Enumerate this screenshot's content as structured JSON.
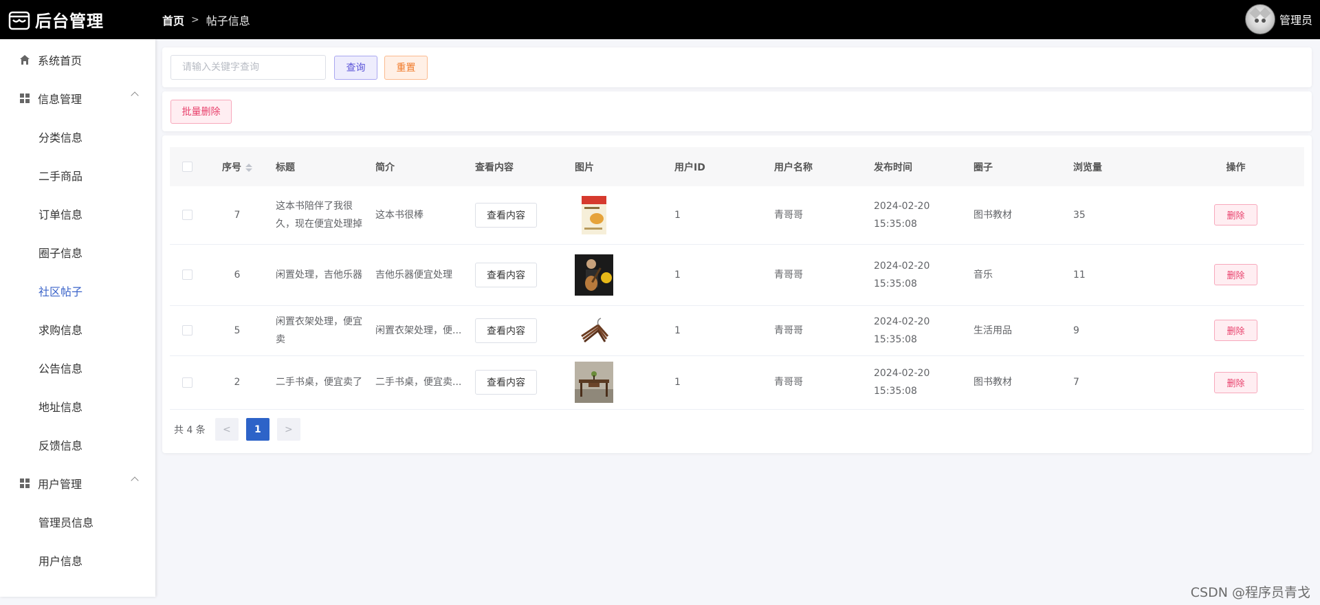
{
  "header": {
    "app_title": "后台管理",
    "breadcrumb_home": "首页",
    "breadcrumb_current": "帖子信息",
    "user_name": "管理员"
  },
  "sidebar": {
    "home": "系统首页",
    "group_info": "信息管理",
    "info_items": [
      "分类信息",
      "二手商品",
      "订单信息",
      "圈子信息",
      "社区帖子",
      "求购信息",
      "公告信息",
      "地址信息",
      "反馈信息"
    ],
    "active_item": "社区帖子",
    "group_user": "用户管理",
    "user_items": [
      "管理员信息",
      "用户信息"
    ]
  },
  "search": {
    "placeholder": "请输入关键字查询",
    "query_label": "查询",
    "reset_label": "重置"
  },
  "actions": {
    "batch_delete_label": "批量删除"
  },
  "table": {
    "headers": [
      "序号",
      "标题",
      "简介",
      "查看内容",
      "图片",
      "用户ID",
      "用户名称",
      "发布时间",
      "圈子",
      "浏览量",
      "操作"
    ],
    "view_label": "查看内容",
    "delete_label": "删除",
    "rows": [
      {
        "id": "7",
        "title": "这本书陪伴了我很久，现在便宜处理掉",
        "intro": "这本书很棒",
        "image": "book-cover",
        "user_id": "1",
        "user_name": "青哥哥",
        "time": "2024-02-20 15:35:08",
        "circle": "图书教材",
        "views": "35"
      },
      {
        "id": "6",
        "title": "闲置处理，吉他乐器",
        "intro": "吉他乐器便宜处理",
        "image": "guitar-photo",
        "user_id": "1",
        "user_name": "青哥哥",
        "time": "2024-02-20 15:35:08",
        "circle": "音乐",
        "views": "11"
      },
      {
        "id": "5",
        "title": "闲置衣架处理，便宜卖",
        "intro": "闲置衣架处理，便...",
        "image": "hanger-photo",
        "user_id": "1",
        "user_name": "青哥哥",
        "time": "2024-02-20 15:35:08",
        "circle": "生活用品",
        "views": "9"
      },
      {
        "id": "2",
        "title": "二手书桌，便宜卖了",
        "intro": "二手书桌，便宜卖...",
        "image": "desk-photo",
        "user_id": "1",
        "user_name": "青哥哥",
        "time": "2024-02-20 15:35:08",
        "circle": "图书教材",
        "views": "7"
      }
    ]
  },
  "pagination": {
    "total_text": "共 4 条",
    "current_page": "1",
    "prev_icon": "chevron-left-icon",
    "next_icon": "chevron-right-icon"
  },
  "watermark": "CSDN @程序员青戈",
  "colors": {
    "header_bg": "#000000",
    "active_menu": "#3a63c9",
    "query_btn": "#5b54d8",
    "reset_btn": "#f07a2a",
    "delete_btn": "#e8416c",
    "page_active": "#2d63c8"
  }
}
